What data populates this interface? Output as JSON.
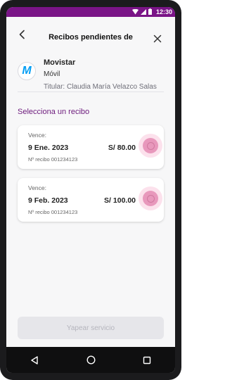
{
  "status_bar": {
    "time": "12:30",
    "icons": [
      "wifi-icon",
      "signal-icon",
      "battery-icon"
    ],
    "background": "#7a1487"
  },
  "header": {
    "title": "Recibos pendientes de",
    "back_icon": "arrow-left-icon",
    "close_icon": "close-icon"
  },
  "company": {
    "logo_glyph": "M",
    "name": "Movistar",
    "service": "Móvil",
    "holder": "Titular: Claudia María Velazco Salas"
  },
  "section_title": "Selecciona un recibo",
  "receipts": [
    {
      "label": "Vence:",
      "due_date": "9 Ene. 2023",
      "amount": "S/ 80.00",
      "receipt_number": "Nº recibo 001234123",
      "selected": false
    },
    {
      "label": "Vence:",
      "due_date": "9 Feb. 2023",
      "amount": "S/ 100.00",
      "receipt_number": "Nº recibo 001234123",
      "selected": false
    }
  ],
  "pay_button": {
    "label": "Yapear servicio",
    "enabled": false
  },
  "nav_bar": [
    "back-triangle-icon",
    "home-circle-icon",
    "recents-square-icon"
  ],
  "colors": {
    "accent": "#6c1a7c",
    "brand_logo": "#019df4",
    "radio": "#e898bc"
  }
}
